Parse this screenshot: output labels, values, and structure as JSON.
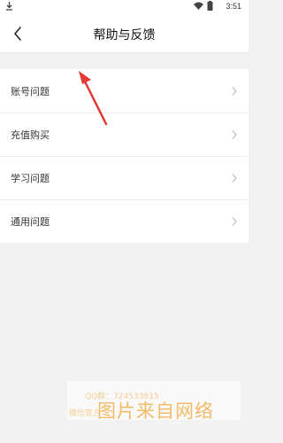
{
  "status_bar": {
    "time": "3:51",
    "icons": [
      "download-icon",
      "wifi-icon",
      "battery-icon"
    ]
  },
  "header": {
    "title": "帮助与反馈",
    "back_icon": "chevron-left-icon"
  },
  "menu": {
    "items": [
      {
        "label": "账号问题"
      },
      {
        "label": "充值购买"
      },
      {
        "label": "学习问题"
      },
      {
        "label": "通用问题"
      }
    ],
    "chevron_icon": "chevron-right-icon"
  },
  "annotation": {
    "color": "#e53935",
    "icon": "arrow-annotation"
  },
  "watermark": {
    "line1": "QQ群：724533815",
    "line2": "微信官方",
    "big": "图片来自网络",
    "color": "#f3b04e"
  },
  "colors": {
    "background": "#f2f2f2",
    "surface": "#ffffff"
  }
}
